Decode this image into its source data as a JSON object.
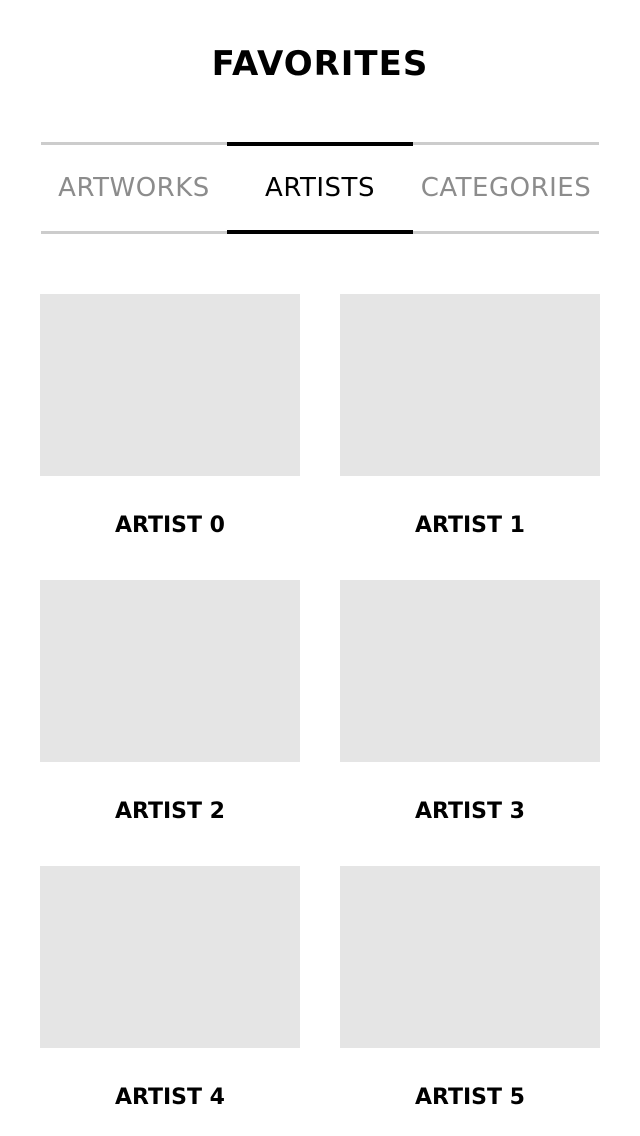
{
  "header": {
    "title": "FAVORITES"
  },
  "tabs": [
    {
      "label": "ARTWORKS",
      "active": false
    },
    {
      "label": "ARTISTS",
      "active": true
    },
    {
      "label": "CATEGORIES",
      "active": false
    }
  ],
  "artists": [
    {
      "name": "ARTIST 0"
    },
    {
      "name": "ARTIST 1"
    },
    {
      "name": "ARTIST 2"
    },
    {
      "name": "ARTIST 3"
    },
    {
      "name": "ARTIST 4"
    },
    {
      "name": "ARTIST 5"
    }
  ],
  "colors": {
    "thumbnail_placeholder": "#e5e5e5",
    "tab_inactive_text": "#8c8c8c",
    "tab_inactive_rule": "#cccccc",
    "tab_active": "#000000"
  }
}
